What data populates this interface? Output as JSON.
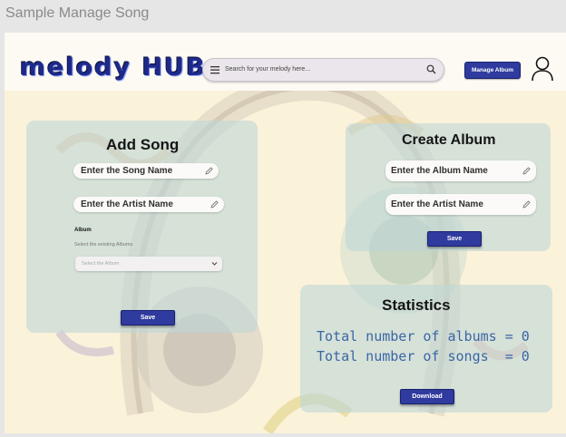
{
  "window": {
    "title": "Sample Manage Song"
  },
  "header": {
    "logo": "melody HUB",
    "search_placeholder": "Search for your melody here...",
    "manage_album_label": "Manage Album"
  },
  "add_song": {
    "title": "Add Song",
    "song_name_placeholder": "Enter the Song Name",
    "artist_name_placeholder": "Enter the Artist Name",
    "album_label": "Album",
    "album_hint": "Select the existing Albums",
    "album_select_placeholder": "Select the Album",
    "save_label": "Save"
  },
  "create_album": {
    "title": "Create Album",
    "album_name_placeholder": "Enter the Album Name",
    "artist_name_placeholder": "Enter the Artist Name",
    "save_label": "Save"
  },
  "statistics": {
    "title": "Statistics",
    "albums_line": "Total number of albums = 0",
    "songs_line": "Total number of songs  = 0",
    "download_label": "Download"
  },
  "colors": {
    "accent": "#2f3b9e",
    "panel": "#bed6d6",
    "background": "#fbf2da"
  },
  "icons": [
    "menu-icon",
    "search-icon",
    "user-icon",
    "pencil-icon",
    "chevron-down-icon"
  ]
}
